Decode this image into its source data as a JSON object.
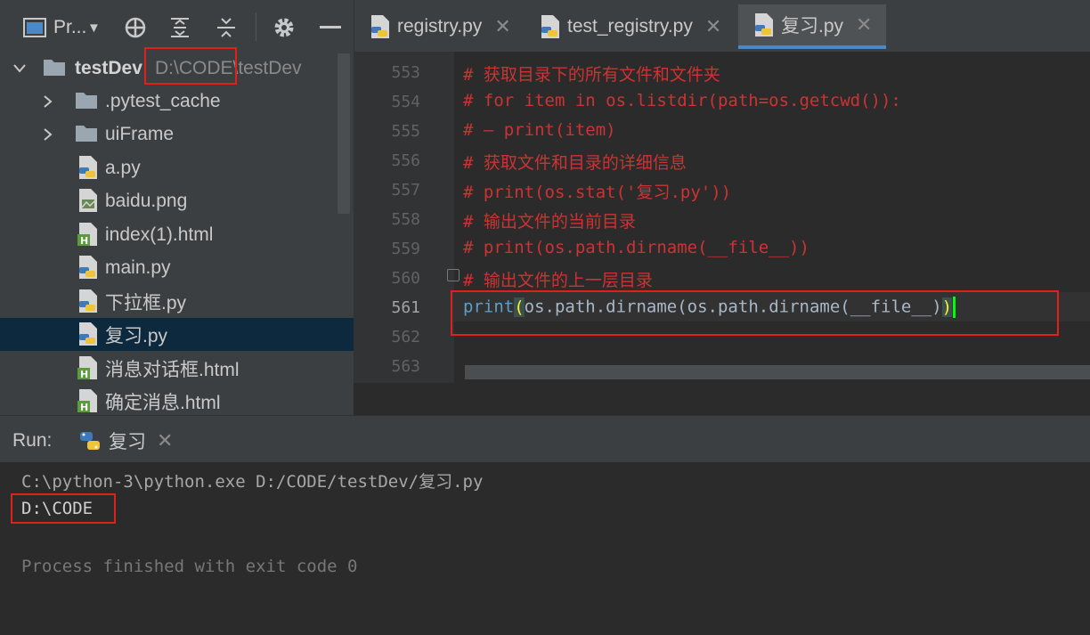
{
  "project_toolbar": {
    "project_label": "Pr...",
    "icons": [
      "project-window-icon",
      "dropdown-caret-icon",
      "locate-target-icon",
      "expand-all-icon",
      "collapse-all-icon",
      "gear-icon",
      "hide-icon"
    ]
  },
  "tree": {
    "root": {
      "name": "testDev",
      "path": "D:\\CODE\\testDev"
    },
    "items": [
      {
        "label": ".pytest_cache",
        "type": "folder"
      },
      {
        "label": "uiFrame",
        "type": "folder"
      },
      {
        "label": "a.py",
        "type": "python"
      },
      {
        "label": "baidu.png",
        "type": "image"
      },
      {
        "label": "index(1).html",
        "type": "html"
      },
      {
        "label": "main.py",
        "type": "python"
      },
      {
        "label": "下拉框.py",
        "type": "python"
      },
      {
        "label": "复习.py",
        "type": "python"
      },
      {
        "label": "消息对话框.html",
        "type": "html"
      },
      {
        "label": "确定消息.html",
        "type": "html"
      }
    ],
    "selected": "复习.py"
  },
  "tabs": [
    {
      "label": "registry.py"
    },
    {
      "label": "test_registry.py"
    },
    {
      "label": "复习.py",
      "active": true
    }
  ],
  "editor": {
    "line_numbers": [
      "553",
      "554",
      "555",
      "556",
      "557",
      "558",
      "559",
      "560",
      "561",
      "562",
      "563"
    ],
    "current_line": "561",
    "lines": [
      "# 获取目录下的所有文件和文件夹",
      "# for item in os.listdir(path=os.getcwd()):",
      "# — print(item)",
      "# 获取文件和目录的详细信息",
      "# print(os.stat('复习.py'))",
      "# 输出文件的当前目录",
      "# print(os.path.dirname(__file__))",
      "# 输出文件的上一层目录"
    ],
    "code_line": {
      "keyword": "print",
      "open_paren": "(",
      "body": "os.path.dirname(os.path.dirname(__file__)",
      "close_paren": ")"
    }
  },
  "run": {
    "title": "Run:",
    "tab_label": "复习",
    "output": {
      "command": "C:\\python-3\\python.exe D:/CODE/testDev/复习.py",
      "result": "D:\\CODE",
      "exit": "Process finished with exit code 0"
    }
  },
  "colors": {
    "highlight_box": "#e0211b",
    "comment": "#cc3333",
    "selection": "#0d293e",
    "tab_accent": "#4a88c7"
  }
}
